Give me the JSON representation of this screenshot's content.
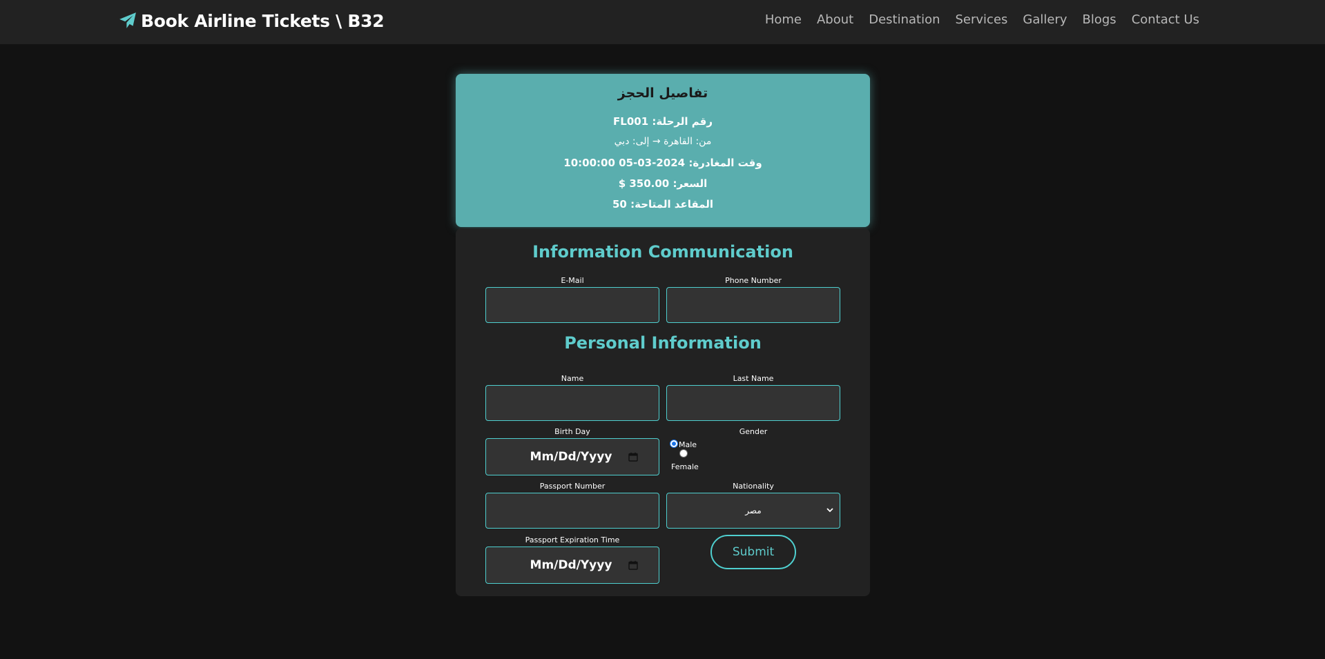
{
  "brand": {
    "title": "Book Airline Tickets \\ B32",
    "icon": "paper-plane-icon",
    "icon_color": "#5fcccc"
  },
  "nav": {
    "items": [
      "Home",
      "About",
      "Destination",
      "Services",
      "Gallery",
      "Blogs",
      "Contact Us"
    ]
  },
  "booking_details": {
    "title": "تفاصيل الحجز",
    "flight_number": "رقم الرحلة: FL001",
    "route": "من: القاهرة → إلى: دبي",
    "departure": "وقت المغادرة: 2024-03-05 10:00:00",
    "price": "السعر: 350.00 $",
    "seats": "المقاعد المتاحة: 50",
    "background": "#5aaeae"
  },
  "form": {
    "contact_section_title": "Information Communication",
    "personal_section_title": "Personal Information",
    "email_label": "E-Mail",
    "phone_label": "Phone Number",
    "name_label": "Name",
    "last_name_label": "Last Name",
    "birthday_label": "Birth Day",
    "birthday_value": "Mm/Dd/Yyyy",
    "gender_label": "Gender",
    "gender_options": [
      "Male",
      "Female"
    ],
    "gender_selected": "Male",
    "passport_number_label": "Passport Number",
    "nationality_label": "Nationality",
    "nationality_value": "مصر",
    "passport_expiration_label": "Passport Expiration Time",
    "passport_expiration_value": "Mm/Dd/Yyyy",
    "submit_label": "Submit",
    "accent": "#5fcccc"
  }
}
